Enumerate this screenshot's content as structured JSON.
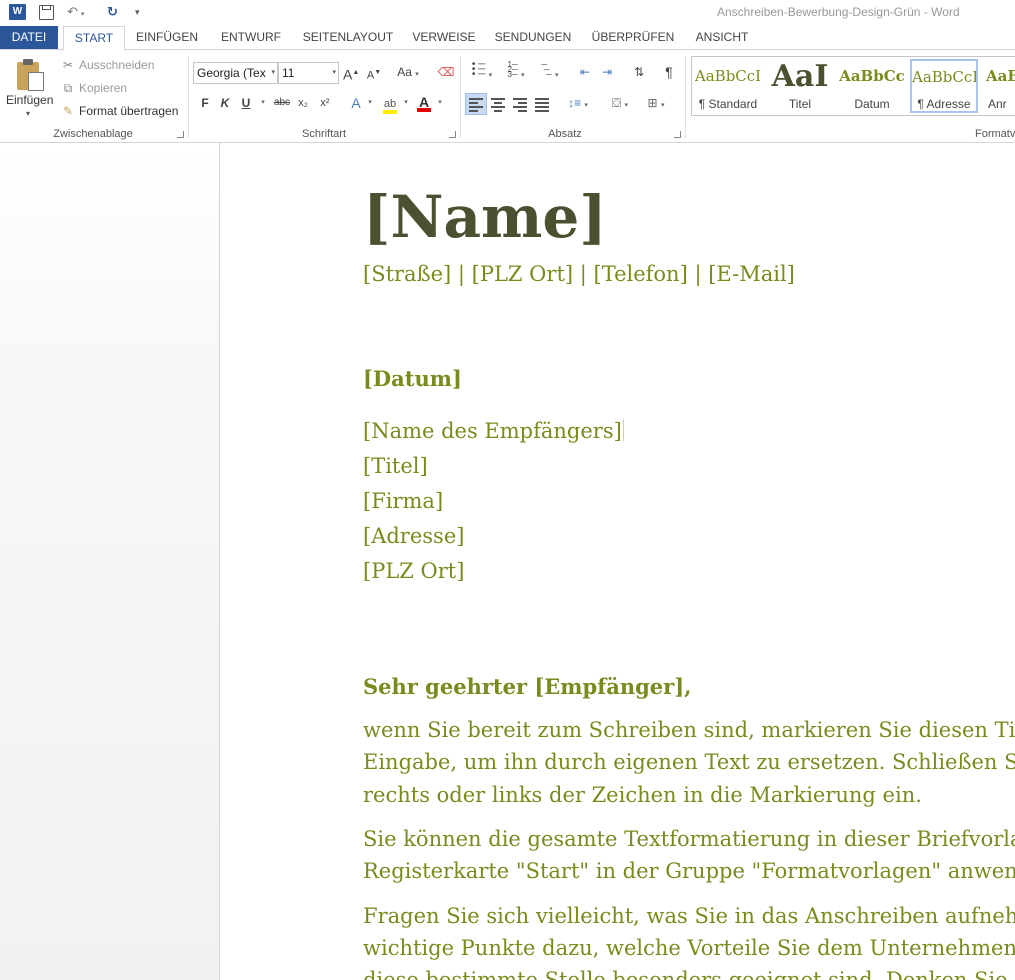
{
  "titlebar": {
    "app_icon_letter": "W",
    "document_title": "Anschreiben-Bewerbung-Design-Grün - Word"
  },
  "tabs": [
    {
      "label": "DATEI"
    },
    {
      "label": "START"
    },
    {
      "label": "EINFÜGEN"
    },
    {
      "label": "ENTWURF"
    },
    {
      "label": "SEITENLAYOUT"
    },
    {
      "label": "VERWEISE"
    },
    {
      "label": "SENDUNGEN"
    },
    {
      "label": "ÜBERPRÜFEN"
    },
    {
      "label": "ANSICHT"
    }
  ],
  "clipboard": {
    "paste_label": "Einfügen",
    "cut_label": "Ausschneiden",
    "copy_label": "Kopieren",
    "format_painter_label": "Format übertragen",
    "group_label": "Zwischenablage"
  },
  "font": {
    "family_value": "Georgia (Tex",
    "size_value": "11",
    "bold_label": "F",
    "italic_label": "K",
    "underline_label": "U",
    "strike_label": "abc",
    "subscript_label": "x₂",
    "superscript_label": "x²",
    "grow_label": "A",
    "shrink_label": "A",
    "case_label": "Aa",
    "effects_label": "A",
    "font_color_label": "A",
    "group_label": "Schriftart"
  },
  "paragraph": {
    "group_label": "Absatz",
    "show_marks_label": "¶"
  },
  "styles": {
    "items": [
      {
        "sample": "AaBbCcI",
        "name": "¶ Standard"
      },
      {
        "sample": "AaI",
        "name": "Titel"
      },
      {
        "sample": "AaBbCc",
        "name": "Datum"
      },
      {
        "sample": "AaBbCcI",
        "name": "¶ Adresse"
      },
      {
        "sample": "AaB",
        "name": "Anr"
      }
    ],
    "group_label": "Formatv"
  },
  "document": {
    "name": "[Name]",
    "contact": "[Straße] | [PLZ Ort] | [Telefon] | [E-Mail]",
    "date": "[Datum]",
    "recipient_lines": [
      "[Name des Empfängers]",
      "[Titel]",
      "[Firma]",
      "[Adresse]",
      "[PLZ Ort]"
    ],
    "salutation": "Sehr geehrter [Empfänger],",
    "body_lines": [
      "wenn Sie bereit zum Schreiben sind, markieren Sie diesen Tipptext, u",
      "Eingabe, um ihn durch eigenen Text zu ersetzen. Schließen Sie am b",
      "rechts oder links der Zeichen in die Markierung ein.",
      "Sie können die gesamte Textformatierung in dieser Briefvorlage mit",
      "Registerkarte \"Start\" in der Gruppe \"Formatvorlagen\" anwenden.",
      "Fragen Sie sich vielleicht, was Sie in das Anschreiben aufnehmen so",
      "wichtige Punkte dazu, welche Vorteile Sie dem Unternehmen bieten",
      "diese bestimmte Stelle besonders geeignet sind. Denken Sie auch da"
    ]
  },
  "colors": {
    "accent_blue": "#2b579a",
    "doc_green": "#7a8a1c",
    "doc_dark": "#4a5030"
  }
}
